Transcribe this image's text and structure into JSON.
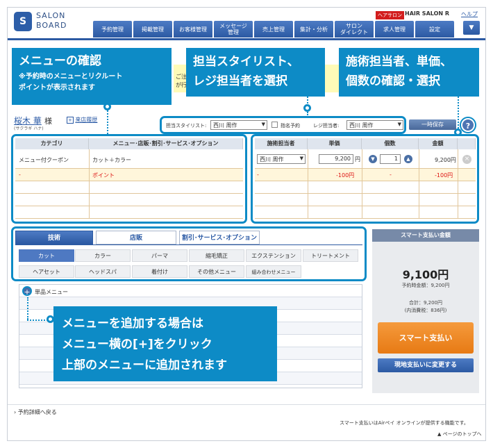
{
  "header": {
    "logo_mark": "S",
    "logo_line1": "SALON",
    "logo_line2": "BOARD",
    "salon_badge": "ヘアサロン",
    "salon_name": "HAIR SALON R",
    "help": "ヘルプ",
    "nav": [
      "予約管理",
      "掲載管理",
      "お客様管理",
      "メッセージ\n管理",
      "売上管理",
      "集計・分析",
      "サロン\nダイレクト",
      "求人管理",
      "設定"
    ],
    "menu_icon": "▼"
  },
  "callouts": {
    "menu_confirm_title": "メニューの確認",
    "menu_confirm_sub": "※予約時のメニューとリクルート\nポイントが表示されます",
    "stylist_select_l1": "担当スタイリスト、",
    "stylist_select_l2": "レジ担当者を選択",
    "price_confirm_l1": "施術担当者、単価、",
    "price_confirm_l2": "個数の確認・選択",
    "add_menu_l1": "メニューを追加する場合は",
    "add_menu_l2": "メニュー横の[+]をクリック",
    "add_menu_l3": "上部のメニューに追加されます"
  },
  "hidden_notice": {
    "a": "ご注",
    "b": "が行"
  },
  "customer": {
    "name": "桜木 華",
    "honorific": "様",
    "kana": "(サクラギ ハナ)",
    "history_link": "来店履歴"
  },
  "stylist_bar": {
    "stylist_label": "担当スタイリスト:",
    "stylist_value": "西川 周作",
    "designated_label": "指名予約",
    "register_label": "レジ担当者:",
    "register_value": "西川 周作",
    "save_button": "一時保存",
    "help": "?"
  },
  "left_table": {
    "headers": [
      "カテゴリ",
      "メニュー･店販･割引･サービス･オプション"
    ],
    "rows": [
      {
        "category": "メニュー付クーポン",
        "item": "カット＋カラー"
      },
      {
        "category": "-",
        "item": "ポイント"
      }
    ]
  },
  "right_table": {
    "headers": [
      "施術担当者",
      "単価",
      "個数",
      "金額"
    ],
    "row1": {
      "staff": "西川 周作",
      "unit": "9,200",
      "yen": "円",
      "qty": "1",
      "amount": "9,200円"
    },
    "row2": {
      "staff": "-",
      "unit": "-100円",
      "qty": "-",
      "amount": "-100円"
    },
    "del_icon": "×"
  },
  "tabs": {
    "main": [
      "技術",
      "店販",
      "割引･サービス･オプション"
    ],
    "sub": [
      "カット",
      "カラー",
      "パーマ",
      "縮毛矯正",
      "エクステンション",
      "トリートメント",
      "ヘアセット",
      "ヘッドスパ",
      "着付け",
      "その他メニュー",
      "組み合わせメニュー"
    ]
  },
  "menu_list": {
    "first_item": "単品メニュー",
    "plus": "+"
  },
  "pay": {
    "title": "スマート支払い金額",
    "amount": "9,100円",
    "reserved": "予約時金額：9,200円",
    "total": "合計：9,200円",
    "tax": "(内消費税：836円)",
    "button": "スマート支払い",
    "change_button": "現地支払いに変更する"
  },
  "footer": {
    "back": "予約詳細へ戻る",
    "note": "スマート支払いはAirペイ オンラインが提供する機能です。",
    "top": "ページのトップへ"
  }
}
